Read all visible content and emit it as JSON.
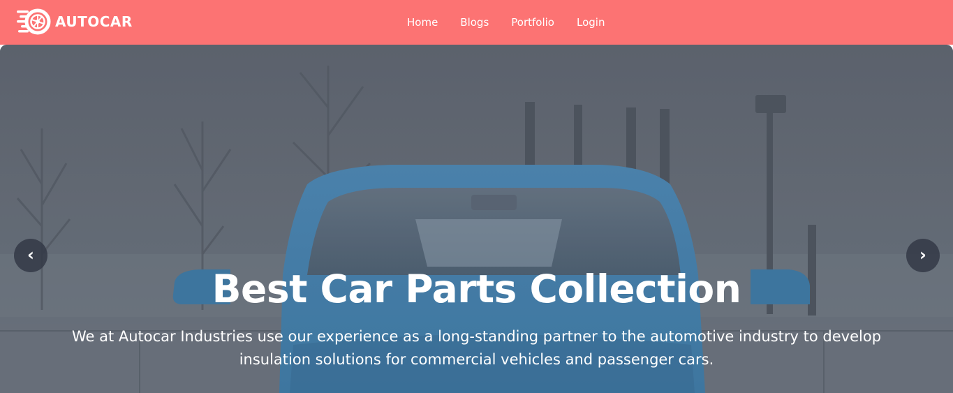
{
  "brand": {
    "name": "AUTOCAR",
    "logo_icon": "wheel-logo-icon"
  },
  "nav": {
    "items": [
      {
        "label": "Home"
      },
      {
        "label": "Blogs"
      },
      {
        "label": "Portfolio"
      },
      {
        "label": "Login"
      }
    ]
  },
  "hero": {
    "title": "Best Car Parts Collection",
    "text": "We at Autocar Industries use our experience as a long-standing partner to the automotive industry to develop insulation solutions for commercial vehicles and passenger cars.",
    "prev_icon": "‹",
    "next_icon": "›"
  },
  "colors": {
    "navbar": "#fc7373",
    "text": "#ffffff",
    "carousel_button": "#343a48"
  }
}
